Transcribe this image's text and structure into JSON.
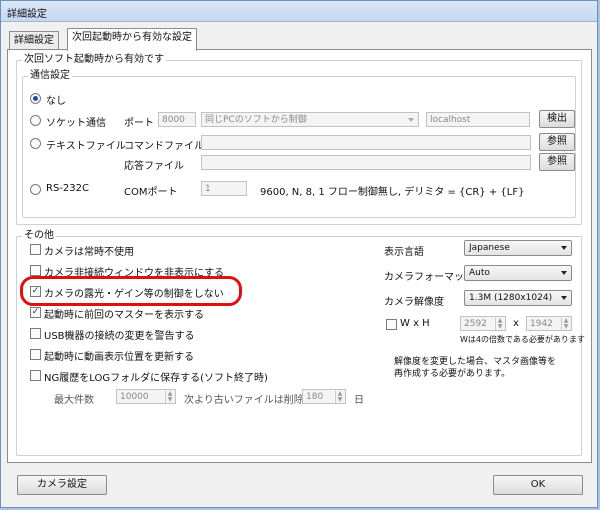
{
  "window": {
    "title": "詳細設定"
  },
  "tabs": [
    "詳細設定",
    "次回起動時から有効な設定"
  ],
  "next_start": {
    "group_title": "次回ソフト起動時から有効です",
    "comm": {
      "legend": "通信設定",
      "none_label": "なし",
      "socket_label": "ソケット通信",
      "port_label": "ポート",
      "port_value": "8000",
      "port_mode": "同じPCのソフトから制御",
      "host_value": "localhost",
      "detect_button": "検出",
      "textfile_label": "テキストファイル",
      "command_file_label": "コマンドファイル",
      "response_file_label": "応答ファイル",
      "browse_button": "参照",
      "rs232c_label": "RS-232C",
      "com_port_label": "COMポート",
      "com_port_value": "1",
      "rs_settings": "9600, N, 8, 1 フロー制御無し, デリミタ = {CR} + {LF}"
    }
  },
  "other": {
    "legend": "その他",
    "checkboxes": [
      {
        "label": "カメラは常時不使用",
        "checked": false
      },
      {
        "label": "カメラ非接続ウィンドウを非表示にする",
        "checked": false
      },
      {
        "label": "カメラの露光・ゲイン等の制御をしない",
        "checked": true
      },
      {
        "label": "起動時に前回のマスターを表示する",
        "checked": true
      },
      {
        "label": "USB機器の接続の変更を警告する",
        "checked": false
      },
      {
        "label": "起動時に動画表示位置を更新する",
        "checked": false
      },
      {
        "label": "NG履歴をLOGフォルダに保存する(ソフト終了時)",
        "checked": false
      }
    ],
    "max_files_label": "最大件数",
    "max_files_value": "10000",
    "delete_older_label": "次より古いファイルは削除",
    "days_value": "180",
    "days_unit": "日",
    "display_language_label": "表示言語",
    "display_language_value": "Japanese",
    "camera_format_label": "カメラフォーマット",
    "camera_format_value": "Auto",
    "camera_resolution_label": "カメラ解像度",
    "camera_resolution_value": "1.3M (1280x1024)",
    "wxh_label": "W x H",
    "width_value": "2592",
    "x_sep": "x",
    "height_value": "1942",
    "w_note": "Wは4の倍数である必要があります",
    "resolution_note_1": "解像度を変更した場合、マスタ画像等を",
    "resolution_note_2": "再作成する必要があります。"
  },
  "footer": {
    "camera_settings_button": "カメラ設定",
    "ok_button": "OK"
  },
  "colors": {
    "highlight_ring": "#e01010",
    "radio_dot": "#1d4e9c"
  }
}
